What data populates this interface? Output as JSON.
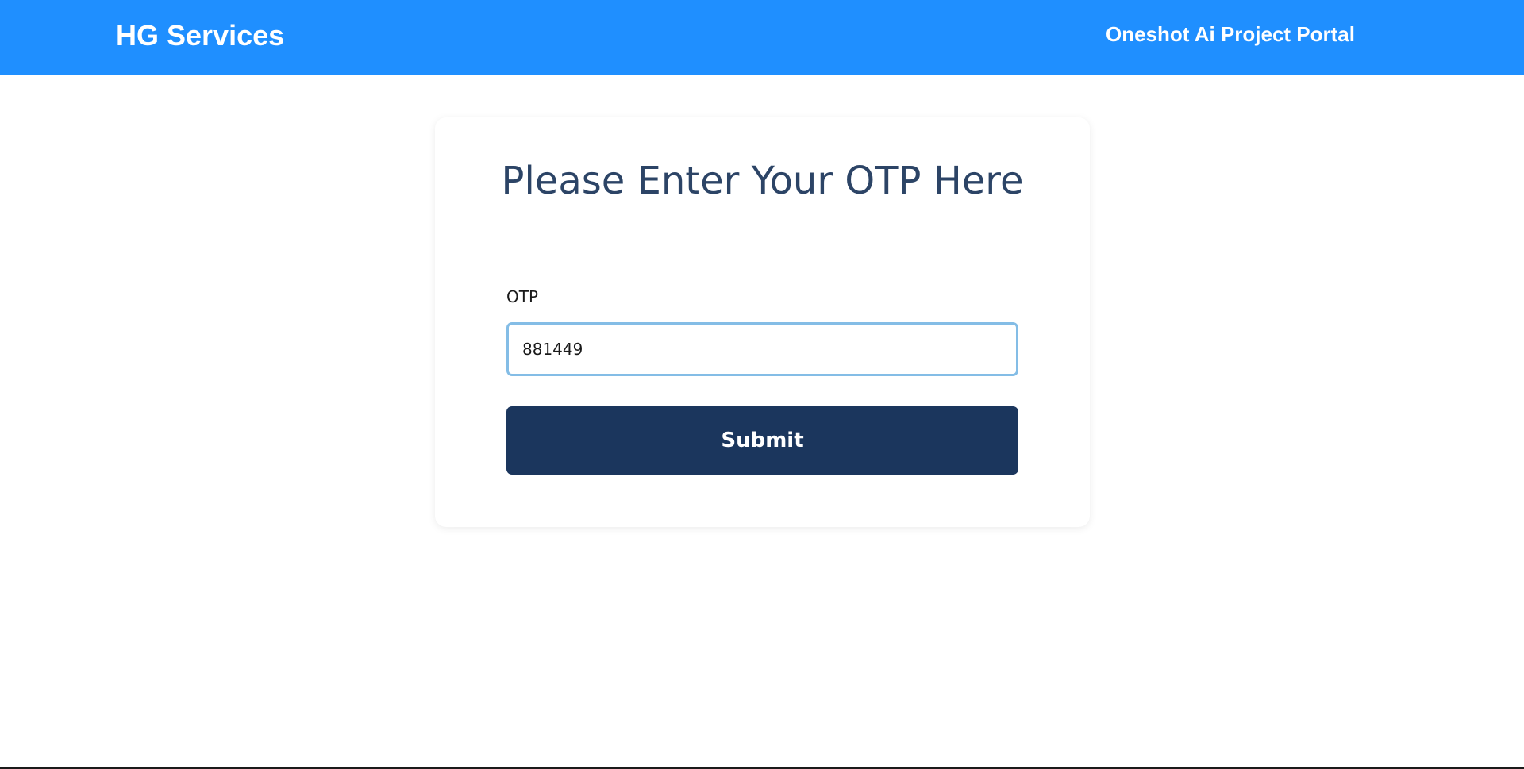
{
  "header": {
    "brand": "HG Services",
    "portal_title": "Oneshot Ai Project Portal",
    "background_color": "#1f8fff"
  },
  "otp_form": {
    "title": "Please Enter Your OTP Here",
    "field_label": "OTP",
    "field_value": "881449",
    "submit_label": "Submit",
    "title_color": "#2c4466",
    "button_color": "#1b365d",
    "input_border_color": "#84bde6"
  }
}
